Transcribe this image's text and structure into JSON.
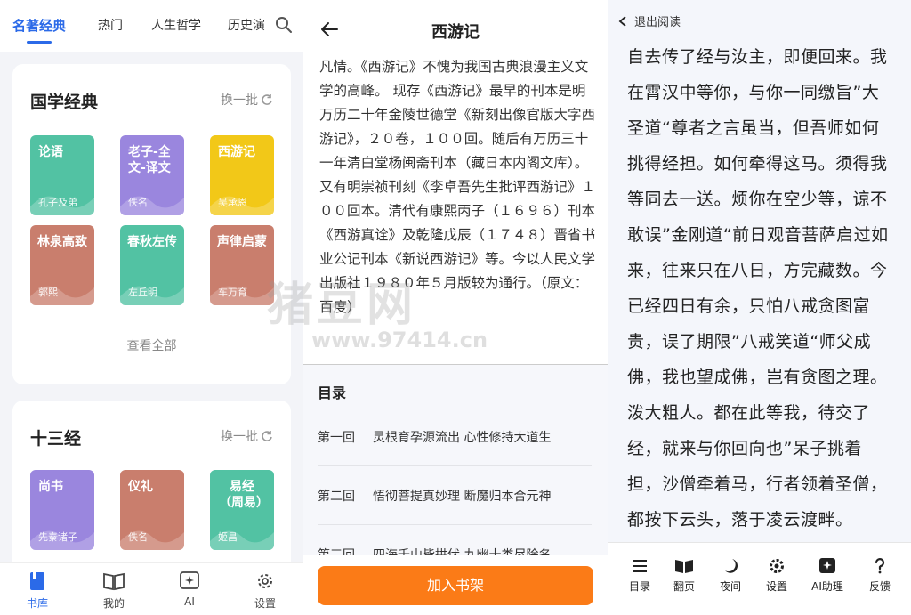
{
  "library": {
    "tabs": [
      "名著经典",
      "热门",
      "人生哲学",
      "历史演"
    ],
    "sections": [
      {
        "title": "国学经典",
        "refresh": "换一批",
        "books": [
          {
            "title": "论语",
            "author": "孔子及弟",
            "color": "#52c2a3"
          },
          {
            "title": "老子-全文-译文",
            "author": "佚名",
            "color": "#9a86de"
          },
          {
            "title": "西游记",
            "author": "吴承恩",
            "color": "#f2c818"
          },
          {
            "title": "林泉高致",
            "author": "郭熙",
            "color": "#c97e6d"
          },
          {
            "title": "春秋左传",
            "author": "左丘明",
            "color": "#52c2a3"
          },
          {
            "title": "声律启蒙",
            "author": "车万育",
            "color": "#c97e6d"
          }
        ],
        "view_all": "查看全部"
      },
      {
        "title": "十三经",
        "refresh": "换一批",
        "books": [
          {
            "title": "尚书",
            "author": "先秦诸子",
            "color": "#9a86de"
          },
          {
            "title": "仪礼",
            "author": "佚名",
            "color": "#c97e6d"
          },
          {
            "title": "易经（周易）",
            "author": "姬昌",
            "color": "#52c2a3"
          }
        ]
      }
    ],
    "bottom_nav": [
      "书库",
      "我的",
      "AI",
      "设置"
    ]
  },
  "detail": {
    "title": "西游记",
    "intro": "凡情。《西游记》不愧为我国古典浪漫主义文学的高峰。 现存《西游记》最早的刊本是明万历二十年金陵世德堂《新刻出像官版大字西游记》，２０卷，１００回。随后有万历三十一年清白堂杨闽斋刊本（藏日本内阁文库）。又有明崇祯刊刻《李卓吾先生批评西游记》１００回本。清代有康熙丙子（１６９６）刊本《西游真诠》及乾隆戊辰（１７４８）晋省书业公记刊本《新说西游记》等。今以人民文学出版社１９８０年５月版较为通行。（原文：百度）",
    "toc_title": "目录",
    "chapters": [
      {
        "num": "第一回",
        "name": "灵根育孕源流出 心性修持大道生"
      },
      {
        "num": "第二回",
        "name": "悟彻菩提真妙理 断魔归本合元神"
      },
      {
        "num": "第三回",
        "name": "四海千山皆拱伏 九幽十类尽除名"
      }
    ],
    "add_button": "加入书架"
  },
  "reader": {
    "exit": "退出阅读",
    "text": "自去传了经与汝主，即便回来。我在霄汉中等你，与你一同缴旨”大圣道“尊者之言虽当，但吾师如何挑得经担。如何牵得这马。须得我等同去一送。烦你在空少等，谅不敢误”金刚道“前日观音菩萨启过如来，往来只在八日，方完藏数。今已经四日有余，只怕八戒贪图富贵，误了期限”八戒笑道“师父成佛，我也望成佛，岂有贪图之理。泼大粗人。都在此等我，待交了经，就来与你回向也”呆子挑着担，沙僧牵着马，行者领着圣僧，都按下云头，落于凌云渡畔。",
    "toolbar": [
      "目录",
      "翻页",
      "夜间",
      "设置",
      "AI助理",
      "反馈"
    ]
  },
  "watermark": {
    "main": "猪豆网",
    "sub": "www.97414.cn"
  }
}
